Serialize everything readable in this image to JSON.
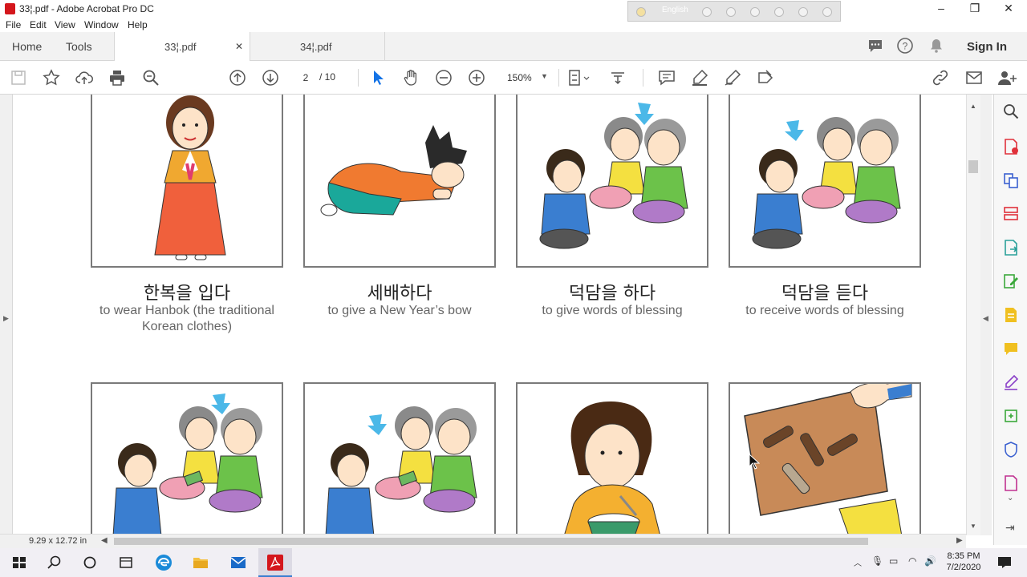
{
  "window": {
    "title": "33¦.pdf - Adobe Acrobat Pro DC",
    "ime_language": "English",
    "controls": [
      "–",
      "❐",
      "✕"
    ]
  },
  "menu": [
    "File",
    "Edit",
    "View",
    "Window",
    "Help"
  ],
  "tabs": {
    "home": "Home",
    "tools": "Tools",
    "documents": [
      {
        "label": "33¦.pdf",
        "close": "✕",
        "active": true
      },
      {
        "label": "34¦.pdf",
        "active": false
      }
    ],
    "sign_in": "Sign In"
  },
  "toolbar": {
    "page_current": "2",
    "page_total": "/ 10",
    "zoom": "150%"
  },
  "status": {
    "page_size": "9.29 x 12.72 in"
  },
  "cards": [
    {
      "korean": "한복을 입다",
      "english": "to wear Hanbok (the traditional Korean clothes)"
    },
    {
      "korean": "세배하다",
      "english": "to give a New Year’s bow"
    },
    {
      "korean": "덕담을 하다",
      "english": "to give words of blessing"
    },
    {
      "korean": "덕담을 듣다",
      "english": "to receive words of blessing"
    }
  ],
  "taskbar": {
    "time": "8:35 PM",
    "date": "7/2/2020"
  },
  "colors": {
    "acrobat_red": "#d4161c",
    "toolbar_blue": "#1473e6",
    "card_border": "#7a7a7a"
  }
}
